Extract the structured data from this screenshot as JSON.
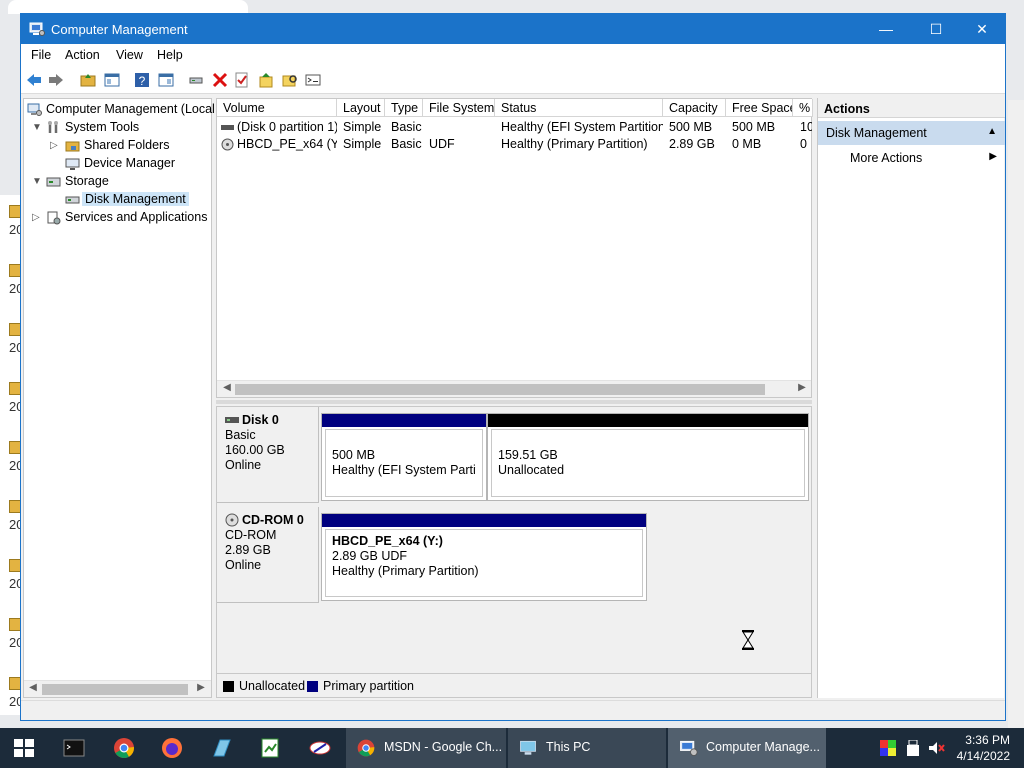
{
  "window": {
    "title": "Computer Management",
    "minimize": "—",
    "maximize": "☐",
    "close": "✕"
  },
  "menu": [
    "File",
    "Action",
    "View",
    "Help"
  ],
  "tree": {
    "root": "Computer Management (Local",
    "system_tools": "System Tools",
    "shared_folders": "Shared Folders",
    "device_manager": "Device Manager",
    "storage": "Storage",
    "disk_management": "Disk Management",
    "services": "Services and Applications"
  },
  "volumes": {
    "columns": [
      "Volume",
      "Layout",
      "Type",
      "File System",
      "Status",
      "Capacity",
      "Free Space",
      "%"
    ],
    "rows": [
      {
        "volume": "(Disk 0 partition 1)",
        "layout": "Simple",
        "type": "Basic",
        "fs": "",
        "status": "Healthy (EFI System Partition)",
        "capacity": "500 MB",
        "free": "500 MB",
        "pct": "10"
      },
      {
        "volume": "HBCD_PE_x64 (Y:)",
        "layout": "Simple",
        "type": "Basic",
        "fs": "UDF",
        "status": "Healthy (Primary Partition)",
        "capacity": "2.89 GB",
        "free": "0 MB",
        "pct": "0"
      }
    ]
  },
  "disks": [
    {
      "name": "Disk 0",
      "kind": "Basic",
      "size": "160.00 GB",
      "state": "Online",
      "partitions": [
        {
          "size": "500 MB",
          "desc": "Healthy (EFI System Partitior"
        },
        {
          "size": "159.51 GB",
          "desc": "Unallocated"
        }
      ]
    },
    {
      "name": "CD-ROM 0",
      "kind": "CD-ROM",
      "size": "2.89 GB",
      "state": "Online",
      "partitions": [
        {
          "title": "HBCD_PE_x64  (Y:)",
          "size": "2.89 GB UDF",
          "desc": "Healthy (Primary Partition)"
        }
      ]
    }
  ],
  "legend": {
    "unallocated": "Unallocated",
    "primary": "Primary partition"
  },
  "actions": {
    "header": "Actions",
    "section": "Disk Management",
    "more": "More Actions"
  },
  "taskbar": {
    "tasks": [
      {
        "label": "MSDN - Google Ch..."
      },
      {
        "label": "This PC"
      },
      {
        "label": "Computer Manage..."
      }
    ],
    "time": "3:36 PM",
    "date": "4/14/2022"
  },
  "background": {
    "year_prefix": "20"
  },
  "colors": {
    "titlebar": "#1b73c9",
    "primary_partition": "#00007f",
    "unallocated": "#000000",
    "taskbar": "#1c2b3a",
    "selection": "#cce4f7"
  }
}
